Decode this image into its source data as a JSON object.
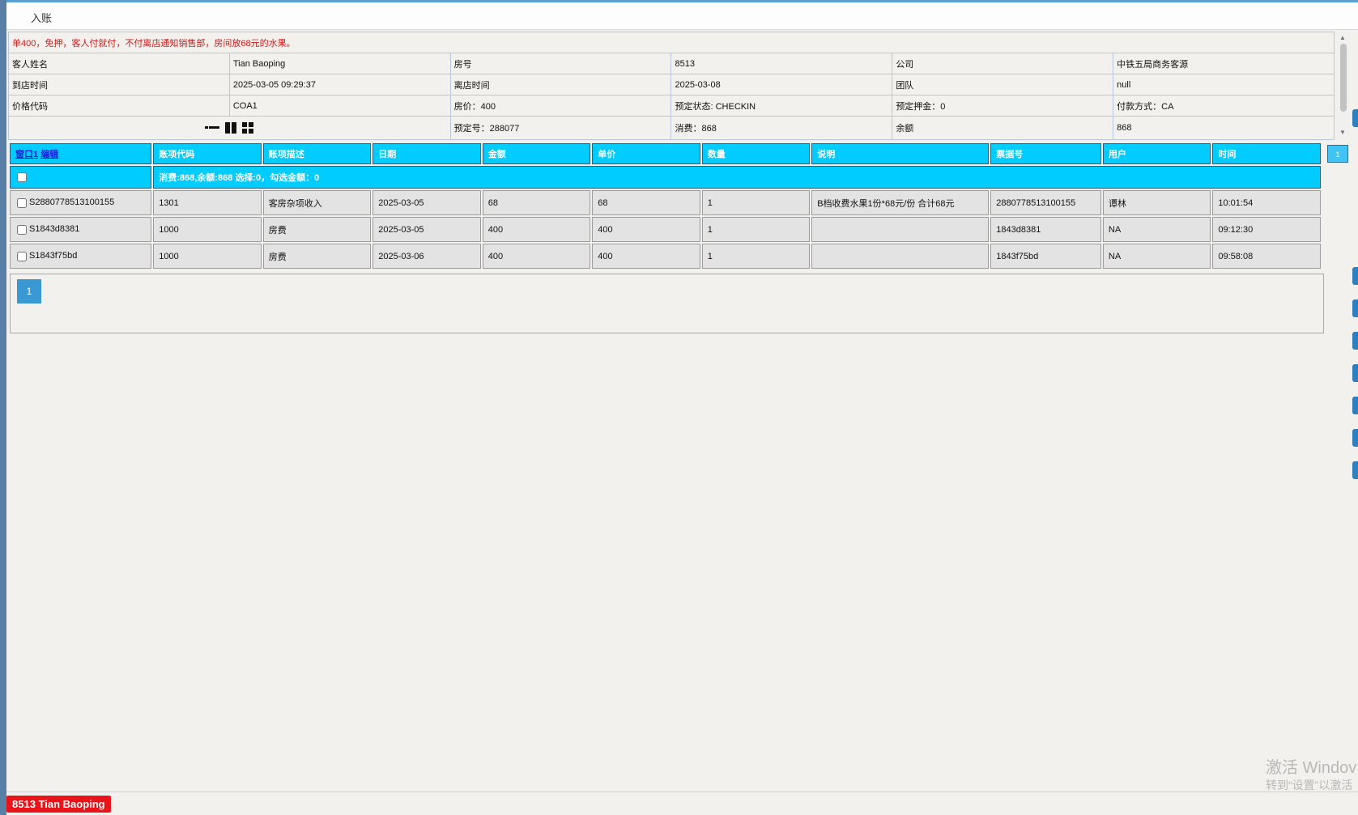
{
  "window": {
    "title": "入账"
  },
  "notice": "单400，免押，客人付就付，不付离店通知销售部，房间放68元的水果。",
  "guest_info": {
    "guest_name_label": "客人姓名",
    "guest_name": "Tian Baoping",
    "room_no_label": "房号",
    "room_no": "8513",
    "company_label": "公司",
    "company": "中铁五局商务客源",
    "arrival_label": "到店时间",
    "arrival": "2025-03-05 09:29:37",
    "departure_label": "离店时间",
    "departure": "2025-03-08",
    "group_label": "团队",
    "group": "null",
    "rate_code_label": "价格代码",
    "rate_code": "COA1",
    "room_rate": "房价：400",
    "booking_status": "预定状态:   CHECKIN",
    "deposit": "预定押金：0",
    "payment": "付款方式：CA",
    "booking_no": "预定号：288077",
    "consumption": "消费：868",
    "balance_label": "余额",
    "balance": "868"
  },
  "layout_icons": [
    "layout-list-icon",
    "layout-two-column-icon",
    "layout-grid-icon"
  ],
  "ledger": {
    "window_link": "窗口1",
    "edit_link": "编辑",
    "columns": [
      "账项代码",
      "账项描述",
      "日期",
      "金额",
      "单价",
      "数量",
      "说明",
      "票据号",
      "用户",
      "时间"
    ],
    "summary": "消费:868,余额:868 选择:0，勾选金额：0",
    "rows": [
      {
        "id": "S2880778513100155",
        "code": "1301",
        "desc": "客房杂项收入",
        "date": "2025-03-05",
        "amount": "68",
        "price": "68",
        "qty": "1",
        "note": "B档收费水果1份*68元/份 合计68元",
        "ticket": "2880778513100155",
        "user": "谭林",
        "time": "10:01:54"
      },
      {
        "id": "S1843d8381",
        "code": "1000",
        "desc": "房费",
        "date": "2025-03-05",
        "amount": "400",
        "price": "400",
        "qty": "1",
        "note": "",
        "ticket": "1843d8381",
        "user": "NA",
        "time": "09:12:30"
      },
      {
        "id": "S1843f75bd",
        "code": "1000",
        "desc": "房费",
        "date": "2025-03-06",
        "amount": "400",
        "price": "400",
        "qty": "1",
        "note": "",
        "ticket": "1843f75bd",
        "user": "NA",
        "time": "09:58:08"
      }
    ]
  },
  "pager": {
    "current_page": "1"
  },
  "side_counter": "1",
  "watermark": {
    "line1": "激活 Windov",
    "line2": "转到“设置”以激活"
  },
  "status_badge": "8513 Tian Baoping",
  "colors": {
    "header_cyan": "#00ccff",
    "notice_red": "#d21a1a",
    "badge_red": "#e8141a",
    "pager_blue": "#3a98d3"
  }
}
